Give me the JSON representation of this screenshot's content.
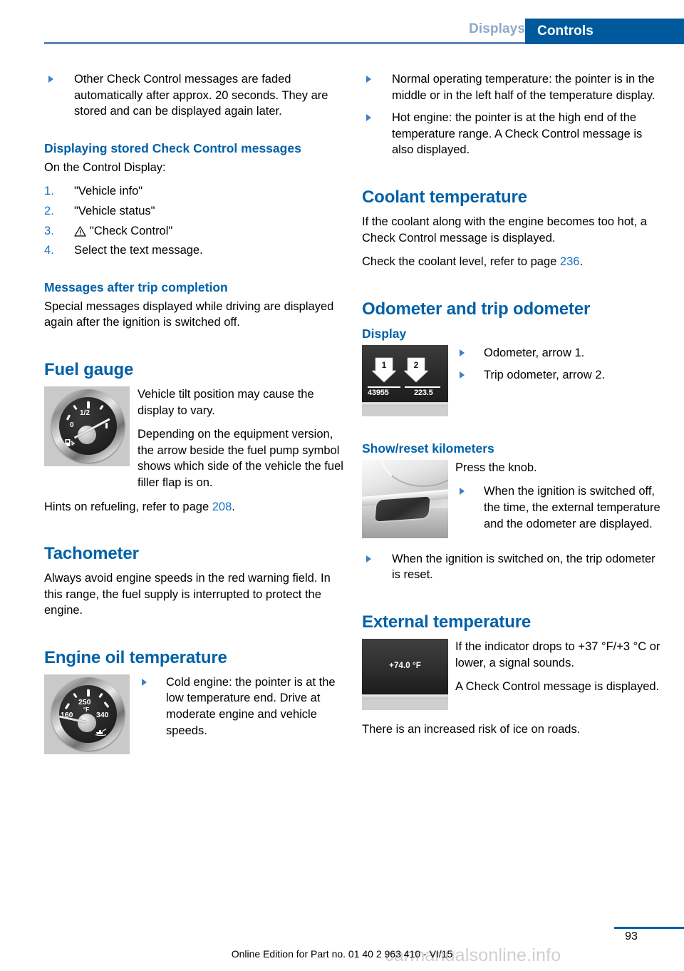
{
  "header": {
    "tab_inactive": "Displays",
    "tab_active": "Controls",
    "accent_blue": "#0061a8",
    "tab_blue": "#00599c",
    "inactive_blue": "#8da9c9"
  },
  "left_column": {
    "bullets_top": [
      "Other Check Control messages are faded automatically after approx. 20 seconds. They are stored and can be displayed again later."
    ],
    "stored_messages": {
      "heading": "Displaying stored Check Control messages",
      "intro": "On the Control Display:",
      "steps": [
        "\"Vehicle info\"",
        "\"Vehicle status\"",
        "\"Check Control\"",
        "Select the text message."
      ],
      "step3_icon": "warning-triangle-icon"
    },
    "after_trip": {
      "heading": "Messages after trip completion",
      "body": "Special messages displayed while driving are displayed again after the ignition is switched off."
    },
    "fuel_gauge": {
      "heading": "Fuel gauge",
      "figure": {
        "name": "fuel-gauge-image",
        "labels": {
          "half": "1/2",
          "zero": "0"
        },
        "icon": "fuel-pump-icon"
      },
      "para1": "Vehicle tilt position may cause the display to vary.",
      "para2": "Depending on the equipment version, the arrow beside the fuel pump symbol shows which side of the vehicle the fuel filler flap is on.",
      "para3_pre": "Hints on refueling, refer to page ",
      "para3_page": "208",
      "para3_post": "."
    },
    "tachometer": {
      "heading": "Tachometer",
      "body": "Always avoid engine speeds in the red warning field. In this range, the fuel supply is interrupted to protect the engine."
    },
    "engine_oil": {
      "heading": "Engine oil temperature",
      "figure": {
        "name": "engine-oil-temperature-gauge-image",
        "labels": {
          "mid": "250",
          "unit": "°F",
          "low": "160",
          "high": "340"
        },
        "icon": "oil-can-icon"
      },
      "bullet": "Cold engine: the pointer is at the low temperature end. Drive at moderate engine and vehicle speeds."
    }
  },
  "right_column": {
    "bullets_top": [
      "Normal operating temperature: the pointer is in the middle or in the left half of the temperature display.",
      "Hot engine: the pointer is at the high end of the temperature range. A Check Control message is also displayed."
    ],
    "coolant": {
      "heading": "Coolant temperature",
      "body": "If the coolant along with the engine becomes too hot, a Check Control message is displayed.",
      "ref_pre": "Check the coolant level, refer to page ",
      "ref_page": "236",
      "ref_post": "."
    },
    "odometer": {
      "heading": "Odometer and trip odometer",
      "subheading": "Display",
      "figure": {
        "name": "odometer-display-image",
        "arrow1": "1",
        "arrow2": "2",
        "odometer_value": "43955",
        "trip_value": "223.5"
      },
      "bullets": [
        "Odometer, arrow 1.",
        "Trip odometer, arrow 2."
      ]
    },
    "show_reset": {
      "heading": "Show/reset kilometers",
      "figure": {
        "name": "reset-knob-image"
      },
      "intro": "Press the knob.",
      "bullet1": "When the ignition is switched off, the time, the external temperature and the odometer are displayed.",
      "bullet2": "When the ignition is switched on, the trip odometer is reset."
    },
    "external_temp": {
      "heading": "External temperature",
      "figure": {
        "name": "external-temperature-display-image",
        "value": "+74.0 °F"
      },
      "para1": "If the indicator drops to +37 °F/+3 °C or lower, a signal sounds.",
      "para2": "A Check Control message is displayed.",
      "para3": "There is an increased risk of ice on roads."
    }
  },
  "footer": {
    "edition": "Online Edition for Part no. 01 40 2 963 410 - VI/15",
    "page_number": "93",
    "watermark": "carmanualsonline.info"
  }
}
